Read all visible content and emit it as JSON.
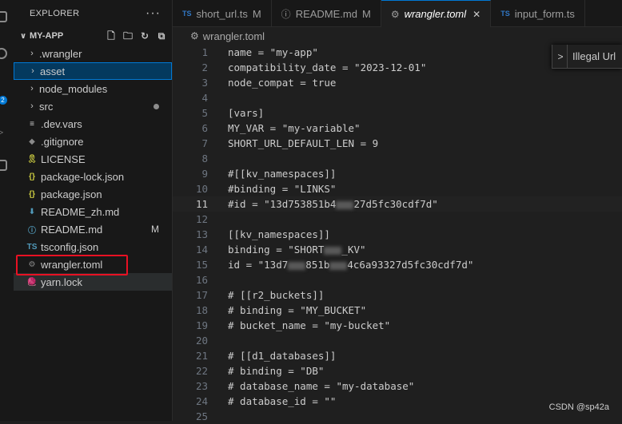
{
  "sidebar": {
    "title": "EXPLORER",
    "more": "···",
    "project": "MY-APP",
    "items": [
      {
        "label": ".wrangler",
        "kind": "folder"
      },
      {
        "label": "asset",
        "kind": "folder"
      },
      {
        "label": "node_modules",
        "kind": "folder"
      },
      {
        "label": "src",
        "kind": "folder"
      },
      {
        "label": ".dev.vars",
        "kind": "file",
        "icon": "≡"
      },
      {
        "label": ".gitignore",
        "kind": "file",
        "icon": "◆"
      },
      {
        "label": "LICENSE",
        "kind": "file",
        "icon": "🎗"
      },
      {
        "label": "package-lock.json",
        "kind": "file",
        "icon": "{}"
      },
      {
        "label": "package.json",
        "kind": "file",
        "icon": "{}"
      },
      {
        "label": "README_zh.md",
        "kind": "file",
        "icon": "⬇"
      },
      {
        "label": "README.md",
        "kind": "file",
        "icon": "ⓘ",
        "status": "M"
      },
      {
        "label": "tsconfig.json",
        "kind": "file",
        "icon": "TS"
      },
      {
        "label": "wrangler.toml",
        "kind": "file",
        "icon": "⚙"
      },
      {
        "label": "yarn.lock",
        "kind": "file",
        "icon": "🧶"
      }
    ]
  },
  "tabs": [
    {
      "icon": "TS",
      "label": "short_url.ts",
      "badge": "M"
    },
    {
      "icon": "ⓘ",
      "label": "README.md",
      "badge": "M"
    },
    {
      "icon": "⚙",
      "label": "wrangler.toml",
      "close": "✕"
    },
    {
      "icon": "TS",
      "label": "input_form.ts"
    }
  ],
  "breadcrumb": "wrangler.toml",
  "find_widget": {
    "label": "Illegal Url",
    "toggle": ">"
  },
  "lines": [
    {
      "n": "1",
      "code": "name = \"my-app\""
    },
    {
      "n": "2",
      "code": "compatibility_date = \"2023-12-01\""
    },
    {
      "n": "3",
      "code": "node_compat = true"
    },
    {
      "n": "4",
      "code": ""
    },
    {
      "n": "5",
      "code": "[vars]"
    },
    {
      "n": "6",
      "code": "MY_VAR = \"my-variable\""
    },
    {
      "n": "7",
      "code": "SHORT_URL_DEFAULT_LEN = 9"
    },
    {
      "n": "8",
      "code": ""
    },
    {
      "n": "9",
      "code": "#[[kv_namespaces]]"
    },
    {
      "n": "10",
      "code": "#binding = \"LINKS\""
    },
    {
      "n": "11",
      "code": "#id = \"13d753851b4",
      "code2": "27d5fc30cdf7d\""
    },
    {
      "n": "12",
      "code": ""
    },
    {
      "n": "13",
      "code": "[[kv_namespaces]]"
    },
    {
      "n": "14",
      "code": "binding = \"SHORT",
      "code2": "_KV\""
    },
    {
      "n": "15",
      "code": "id = \"13d7",
      "code2": "851b",
      "code3": "4c6a93327d5fc30cdf7d\""
    },
    {
      "n": "16",
      "code": ""
    },
    {
      "n": "17",
      "code": "# [[r2_buckets]]"
    },
    {
      "n": "18",
      "code": "# binding = \"MY_BUCKET\""
    },
    {
      "n": "19",
      "code": "# bucket_name = \"my-bucket\""
    },
    {
      "n": "20",
      "code": ""
    },
    {
      "n": "21",
      "code": "# [[d1_databases]]"
    },
    {
      "n": "22",
      "code": "# binding = \"DB\""
    },
    {
      "n": "23",
      "code": "# database_name = \"my-database\""
    },
    {
      "n": "24",
      "code": "# database_id = \"\""
    },
    {
      "n": "25",
      "code": ""
    }
  ],
  "watermark": "CSDN @sp42a"
}
